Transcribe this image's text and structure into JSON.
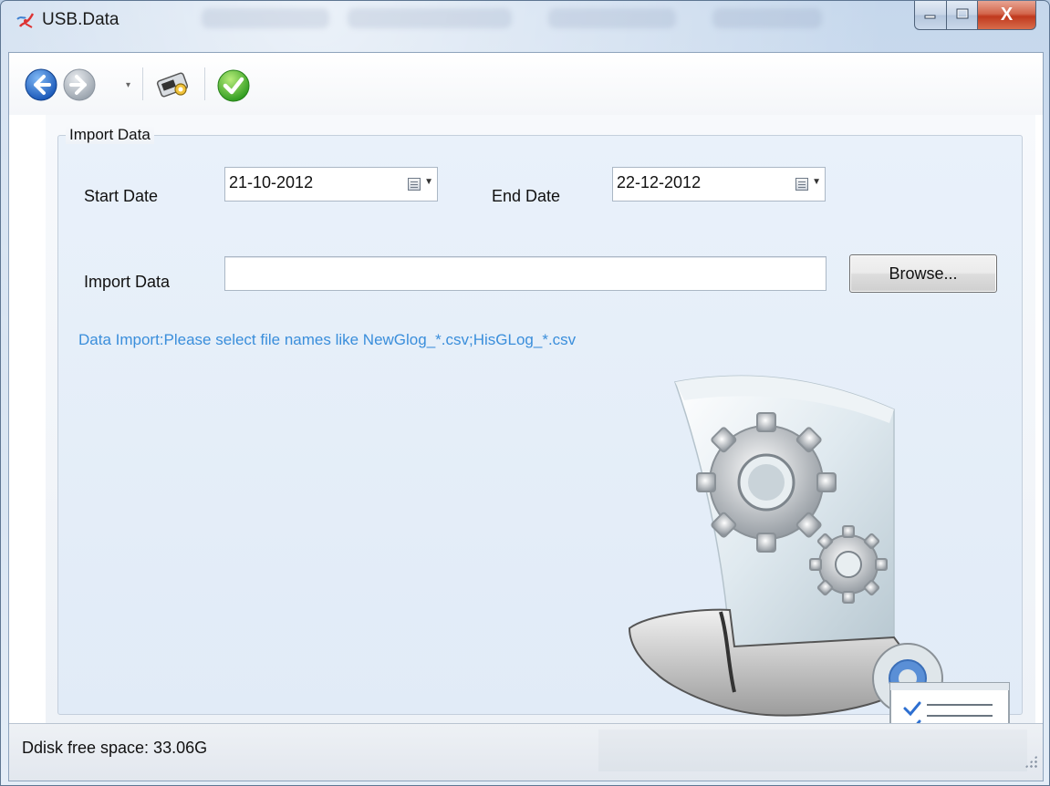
{
  "window": {
    "title": "USB.Data",
    "close_glyph": "X"
  },
  "toolbar": {
    "items": [
      {
        "name": "back-icon",
        "color": "#1e6fd0"
      },
      {
        "name": "forward-icon",
        "color": "#9aa3ad"
      },
      {
        "name": "usb-device-icon"
      },
      {
        "name": "confirm-check-icon",
        "color": "#3fae2a"
      }
    ]
  },
  "import_group": {
    "legend": "Import Data",
    "start_date_label": "Start Date",
    "start_date_value": "21-10-2012",
    "end_date_label": "End Date",
    "end_date_value": "22-12-2012",
    "import_label": "Import Data",
    "import_value": "",
    "browse_label": "Browse...",
    "hint": "Data Import:Please select file names like NewGlog_*.csv;HisGLog_*.csv"
  },
  "statusbar": {
    "free_space": "Ddisk free space:  33.06G"
  },
  "colors": {
    "hint": "#3a8edb",
    "group_background": "#e5eef8"
  }
}
